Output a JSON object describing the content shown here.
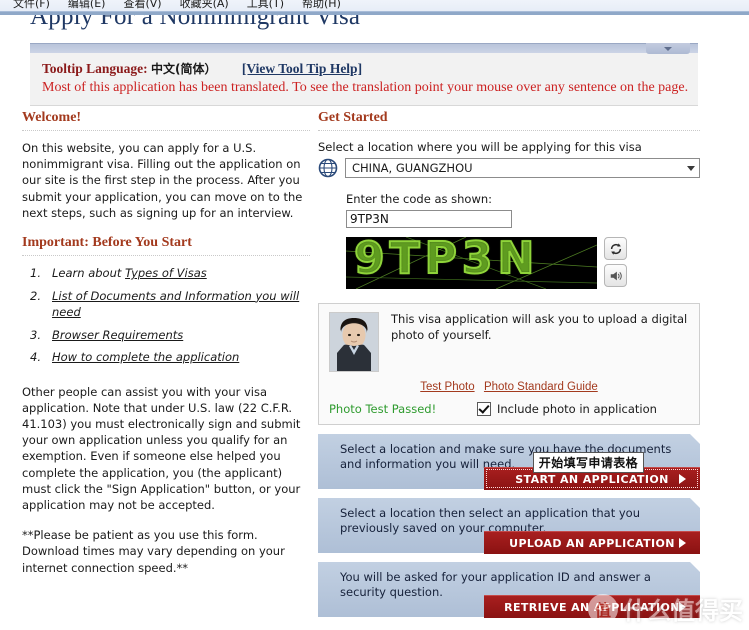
{
  "browser": {
    "menu_items": [
      "文件(F)",
      "编辑(E)",
      "查看(V)",
      "收藏夹(A)",
      "工具(T)",
      "帮助(H)"
    ]
  },
  "page": {
    "title": "Apply For a Nonimmigrant Visa"
  },
  "tooltip_bar": {
    "label": "Tooltip Language:",
    "language": "中文(简体）",
    "help_link": "[View Tool Tip Help]",
    "notice": "Most of this application has been translated. To see the translation point your mouse over any sentence on the page.",
    "collapse_icon": "chevron-down-icon"
  },
  "welcome": {
    "heading": "Welcome!",
    "intro": "On this website, you can apply for a U.S. nonimmigrant visa. Filling out the application on our site is the first step in the process. After you submit your application, you can move on to the next steps, such as signing up for an interview.",
    "before_start_heading": "Important: Before You Start",
    "steps": [
      {
        "prefix": "Learn about ",
        "link": "Types of Visas"
      },
      {
        "prefix": "",
        "link": "List of Documents and Information you will need"
      },
      {
        "prefix": "",
        "link": "Browser Requirements"
      },
      {
        "prefix": "",
        "link": "How to complete the application"
      }
    ],
    "assist_note": "Other people can assist you with your visa application. Note that under U.S. law (22 C.F.R. 41.103) you must electronically sign and submit your own application unless you qualify for an exemption. Even if someone else helped you complete the application, you (the applicant) must click the \"Sign Application\" button, or your application may not be accepted.",
    "patience_note": "**Please be patient as you use this form. Download times may vary depending on your internet connection speed.**"
  },
  "get_started": {
    "heading": "Get Started",
    "location_label": "Select a location where you will be applying for this visa",
    "location_value": "CHINA, GUANGZHOU",
    "location_icon": "globe-icon",
    "dropdown_icon": "chevron-down-icon",
    "code_label": "Enter the code as shown:",
    "code_value": "9TP3N",
    "code_placeholder": "",
    "captcha_text": "9TP3N",
    "refresh_icon": "refresh-icon",
    "audio_icon": "speaker-icon"
  },
  "photo": {
    "description": "This visa application will ask you to upload a digital photo of yourself.",
    "test_photo_link": "Test Photo",
    "standard_guide_link": "Photo Standard Guide",
    "status": "Photo Test Passed!",
    "status_color": "#2e9b2e",
    "include_label": "Include photo in application",
    "include_checked": true,
    "avatar_icon": "applicant-photo"
  },
  "actions": [
    {
      "text": "Select a location and make sure you have the documents and information you will need.",
      "button": "START AN APPLICATION",
      "tooltip": "开始填写申请表格",
      "arrow_icon": "arrow-right-icon"
    },
    {
      "text": "Select a location then select an application that you previously saved on your computer.",
      "button": "UPLOAD AN APPLICATION",
      "tooltip": "",
      "arrow_icon": "arrow-right-icon"
    },
    {
      "text": "You will be asked for your application ID and answer a security question.",
      "button": "RETRIEVE AN APPLICATION",
      "tooltip": "",
      "arrow_icon": "arrow-right-icon"
    }
  ],
  "watermark": {
    "badge": "值",
    "text": "什么值得买"
  }
}
